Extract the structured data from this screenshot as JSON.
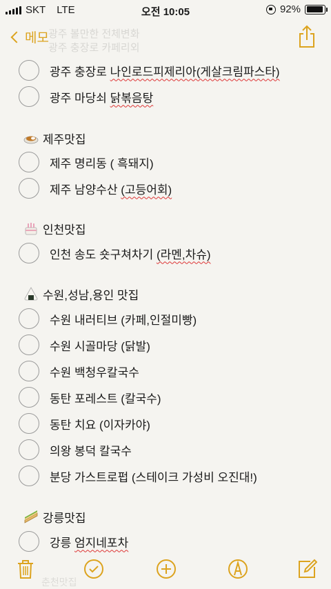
{
  "status": {
    "carrier": "SKT",
    "network": "LTE",
    "time": "오전 10:05",
    "battery": "92%",
    "battery_level": 0.92
  },
  "nav": {
    "back_label": "메모",
    "faded_title": "광주 볼만한 전체변화",
    "faded_sub": "광주 충장로 카페리외"
  },
  "note": {
    "gwangju_items": [
      {
        "plain": "광주 충장로 ",
        "marked": "나인로드피제리아(게살크림파스타)"
      },
      {
        "plain": "광주 마당쇠 ",
        "marked": "닭볶음탕"
      }
    ],
    "jeju": {
      "heading": "제주맛집",
      "items": [
        {
          "plain": "제주 명리동 ( 흑돼지)",
          "marked": ""
        },
        {
          "plain": "제주 남양수산 ",
          "marked": "(고등어회)"
        }
      ]
    },
    "incheon": {
      "heading": "인천맛집",
      "items": [
        {
          "plain": "인천 송도 숏구쳐차기 ",
          "marked": "(라멘,차슈)"
        }
      ]
    },
    "suwon": {
      "heading": "수원,성남,용인 맛집",
      "items": [
        {
          "plain": "수원 내러티브 (카페,인절미빵)",
          "marked": ""
        },
        {
          "plain": "수원 시골마당 (닭발)",
          "marked": ""
        },
        {
          "plain": "수원 백청우칼국수",
          "marked": ""
        },
        {
          "plain": "동탄 포레스트 (칼국수)",
          "marked": ""
        },
        {
          "plain": "동탄 치요 (이자카야)",
          "marked": ""
        },
        {
          "plain": "의왕 봉덕 칼국수",
          "marked": ""
        },
        {
          "plain": "분당 가스트로펍 (스테이크 가성비 오진대!)",
          "marked": ""
        }
      ]
    },
    "gangneung": {
      "heading": "강릉맛집",
      "items": [
        {
          "plain": "강릉 ",
          "marked": "엄지네포차"
        }
      ]
    }
  },
  "footer_faded": "춘천맛집",
  "icons": {
    "accent": "#dca31e",
    "toolbar": [
      "trash-icon",
      "checklist-icon",
      "add-icon",
      "markup-icon",
      "compose-icon"
    ]
  }
}
